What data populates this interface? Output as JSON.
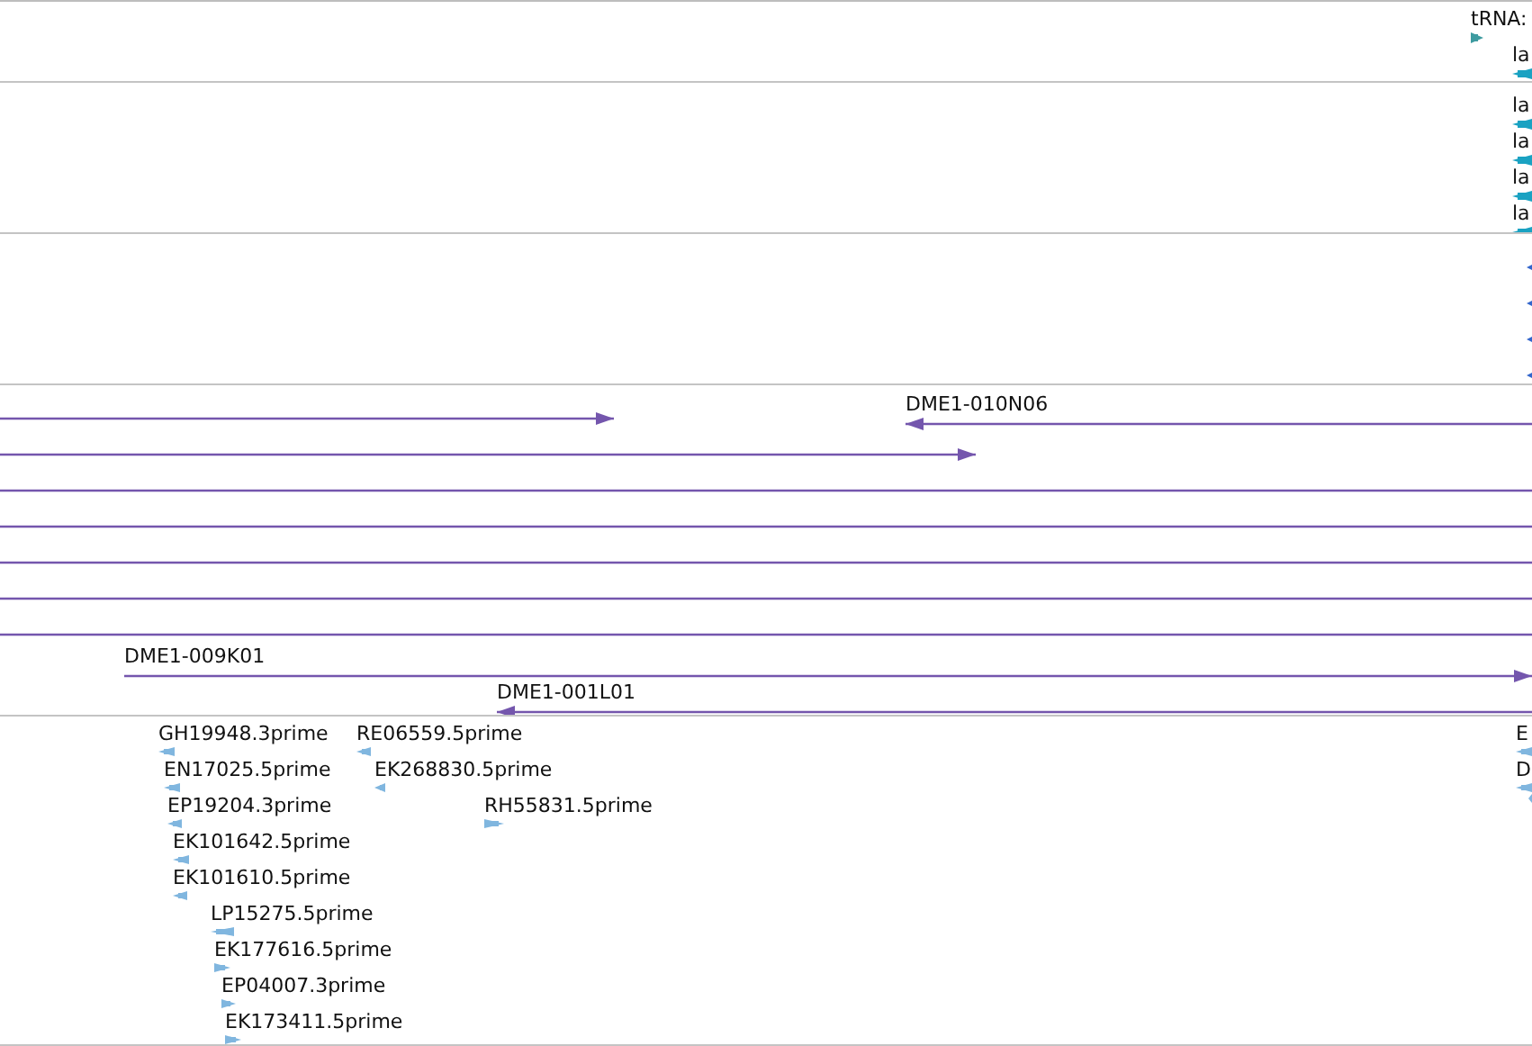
{
  "tracks": [
    {
      "kind": "trna",
      "features": [
        {
          "label": "tRNA:",
          "reverse": false
        }
      ]
    },
    {
      "kind": "gene",
      "features": [
        {
          "label": "la",
          "reverse": true
        }
      ]
    },
    {
      "kind": "gene",
      "features": [
        {
          "label": "la",
          "reverse": true
        },
        {
          "label": "la",
          "reverse": true
        },
        {
          "label": "la",
          "reverse": true
        },
        {
          "label": "la",
          "reverse": true
        }
      ]
    },
    {
      "kind": "dot",
      "features": [
        {
          "reverse": true
        },
        {
          "reverse": true
        },
        {
          "reverse": true
        },
        {
          "reverse": true
        }
      ]
    },
    {
      "kind": "clone",
      "features": [
        {
          "reverse": false,
          "head_in_view": true
        },
        {
          "label": "DME1-010N06",
          "reverse": true,
          "head_in_view": true
        },
        {
          "reverse": false,
          "head_in_view": true
        },
        {
          "head_in_view": false
        },
        {
          "head_in_view": false
        },
        {
          "head_in_view": false
        },
        {
          "head_in_view": false
        },
        {
          "head_in_view": false
        },
        {
          "label": "DME1-009K01",
          "reverse": false,
          "head_in_view": true
        },
        {
          "label": "DME1-001L01",
          "reverse": true,
          "head_in_view": true
        }
      ]
    },
    {
      "kind": "est",
      "features": [
        {
          "label": "GH19948.3prime",
          "reverse": true
        },
        {
          "label": "RE06559.5prime",
          "reverse": true
        },
        {
          "label": "EN17025.5prime",
          "reverse": true
        },
        {
          "label": "EK268830.5prime",
          "reverse": true
        },
        {
          "label": "EP19204.3prime",
          "reverse": true
        },
        {
          "label": "RH55831.5prime",
          "reverse": false
        },
        {
          "label": "EK101642.5prime",
          "reverse": true
        },
        {
          "label": "EK101610.5prime",
          "reverse": true
        },
        {
          "label": "LP15275.5prime",
          "reverse": true
        },
        {
          "label": "EK177616.5prime",
          "reverse": false
        },
        {
          "label": "EP04007.3prime",
          "reverse": false
        },
        {
          "label": "EK173411.5prime",
          "reverse": false
        },
        {
          "label": "E",
          "reverse": true
        },
        {
          "label": "D",
          "reverse": true
        },
        {
          "reverse": true
        }
      ]
    }
  ]
}
